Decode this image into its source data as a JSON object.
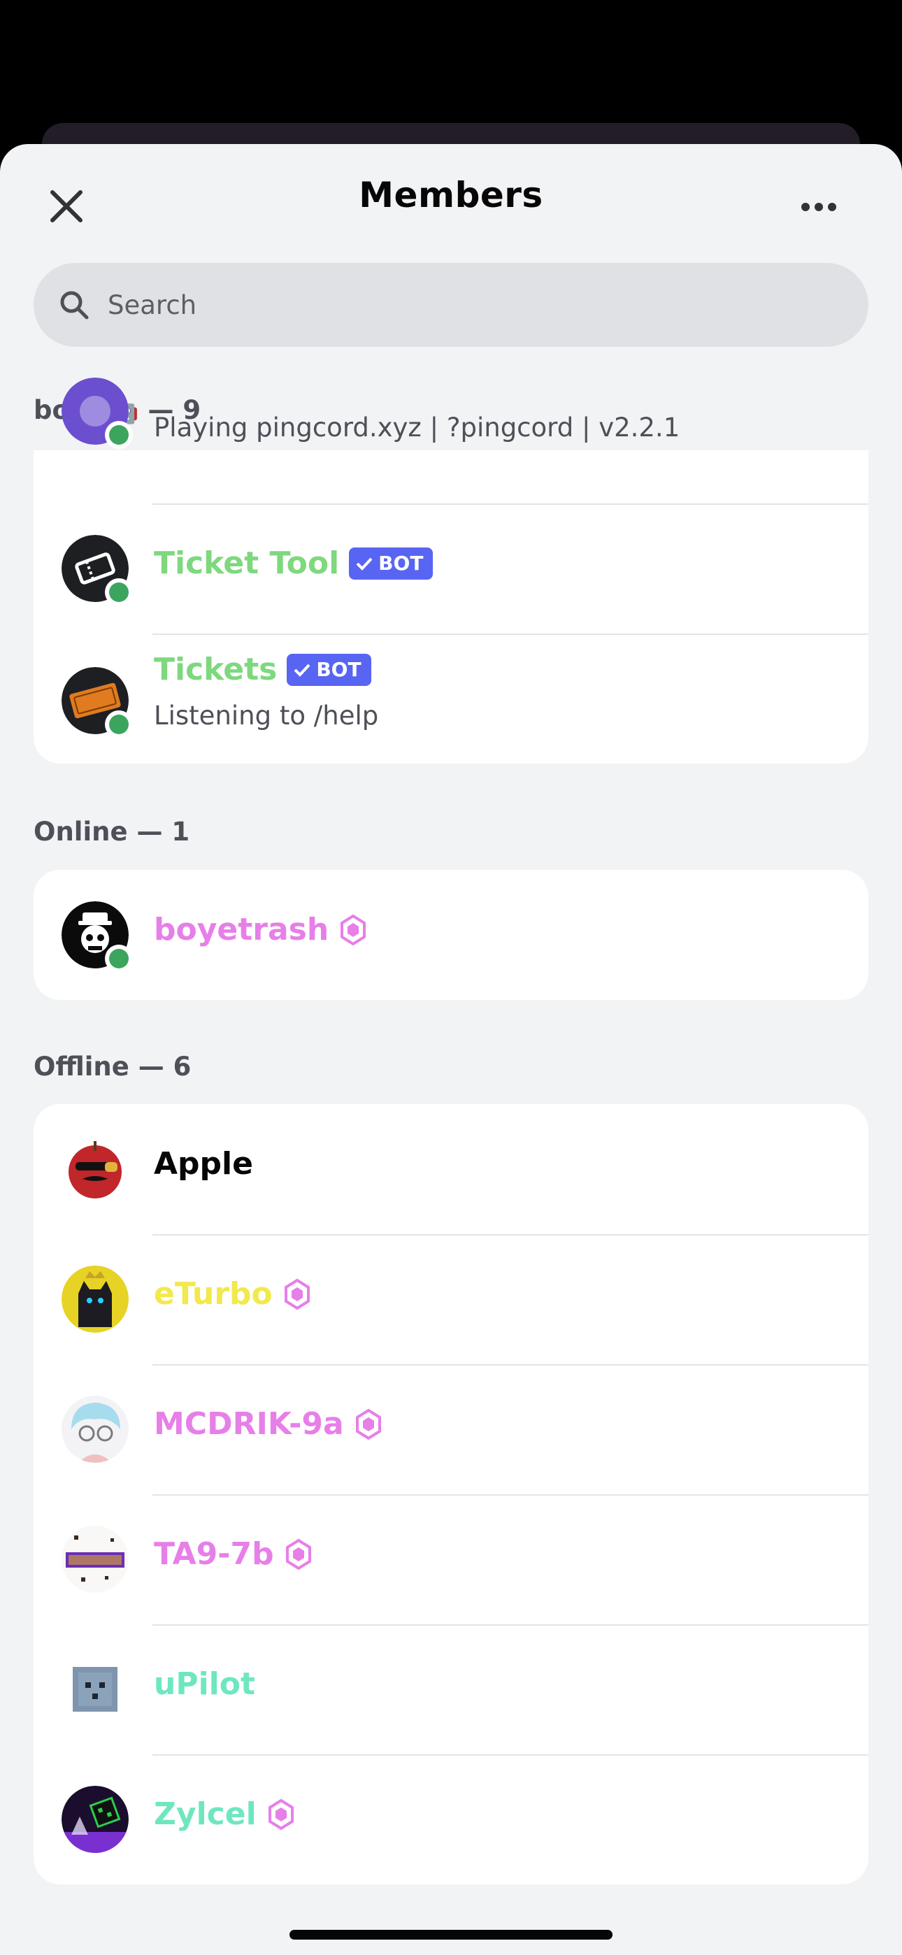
{
  "header": {
    "title": "Members"
  },
  "search": {
    "placeholder": "Search"
  },
  "sections": [
    {
      "label": "bots 🤖 — 9"
    },
    {
      "label": "Online — 1"
    },
    {
      "label": "Offline — 6"
    }
  ],
  "bots": [
    {
      "activity": "Playing pingcord.xyz | ?pingcord | v2.2.1"
    },
    {
      "name": "Ticket Tool",
      "tag": "BOT",
      "name_color": "#7ed87e"
    },
    {
      "name": "Tickets",
      "tag": "BOT",
      "activity": "Listening to /help",
      "name_color": "#7ed87e"
    }
  ],
  "online": [
    {
      "name": "boyetrash",
      "name_color": "#e77fe8",
      "badge": "boost-icon"
    }
  ],
  "offline": [
    {
      "name": "Apple",
      "name_color": "#060607"
    },
    {
      "name": "eTurbo",
      "name_color": "#f2e94a",
      "badge": "boost-icon"
    },
    {
      "name": "MCDRIK-9a",
      "name_color": "#e77fe8",
      "badge": "boost-icon"
    },
    {
      "name": "TA9-7b",
      "name_color": "#e77fe8",
      "badge": "boost-icon"
    },
    {
      "name": "uPilot",
      "name_color": "#6ee7c0"
    },
    {
      "name": "Zylcel",
      "name_color": "#6ee7c0",
      "badge": "boost-icon"
    }
  ],
  "colors": {
    "online": "#3ba55d",
    "bot_tag": "#5865f2",
    "boost": "#e77fe8"
  }
}
